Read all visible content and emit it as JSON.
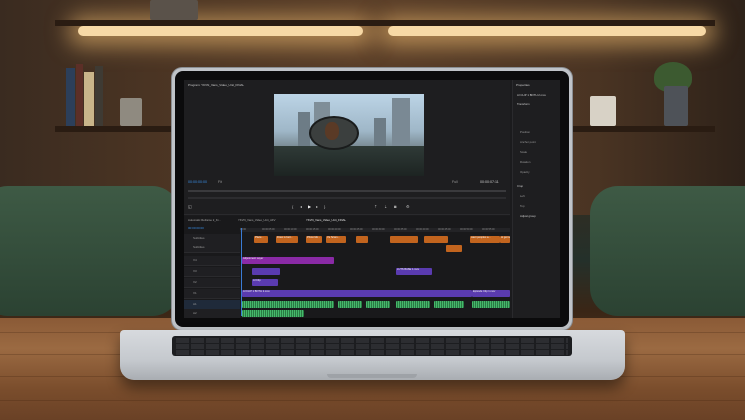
{
  "program_monitor": {
    "title": "Program: YKVN_Vans_Video_Unit_FINAL",
    "timecode_current": "00:00:00:00",
    "fit": "Fit",
    "quality": "Full",
    "timecode_duration": "00:00:07:11"
  },
  "properties": {
    "title": "Properties",
    "clip": "AI CLIP 1 BOTH 2.mov",
    "section_transform": "Transform",
    "items": [
      "Position",
      "Anchor point",
      "Scale",
      "Rotation",
      "Opacity"
    ],
    "section_crop": "Crop",
    "crop_items": [
      "Left",
      "Top"
    ],
    "adjust_button": "Adjust group"
  },
  "timeline": {
    "tabs": [
      "Automatic Reframe 2_Ki...",
      "YKVN_Vans_Video_Unit_AFV",
      "YKVN_Vans_Video_Unit_FINAL"
    ],
    "timecode": "00:00:00:00",
    "ruler": [
      "00:00",
      "00:00:05:00",
      "00:00:10:00",
      "00:00:15:00",
      "00:00:20:00",
      "00:00:25:00",
      "00:00:30:00",
      "00:00:35:00",
      "00:00:40:00",
      "00:00:45:00",
      "00:00:50:00",
      "00:00:55:00"
    ],
    "tracks": [
      "Subtitles",
      "Subtitles",
      "V4",
      "V3",
      "V2",
      "V1",
      "A1",
      "A2",
      "A3"
    ],
    "captions": [
      "Place...",
      "Drew is bett...",
      "Photo Mo...",
      "It's Scam...",
      "want peoples a...",
      "to get sti..."
    ],
    "clips": {
      "adjustment": "Adjustment Layer",
      "v2_a": "AI Clip",
      "v2_b": "LUTS BASE 1.mov",
      "v1_a": "AI CLIP 1 BOTH 2.mov",
      "v1_b": "Episode Clip 1.mov"
    }
  },
  "colors": {
    "caption": "#c2641e",
    "adjustment": "#8a2aa6",
    "video": "#5a3bb0",
    "audio": "#2a7a44",
    "playhead": "#3a7bd5"
  }
}
